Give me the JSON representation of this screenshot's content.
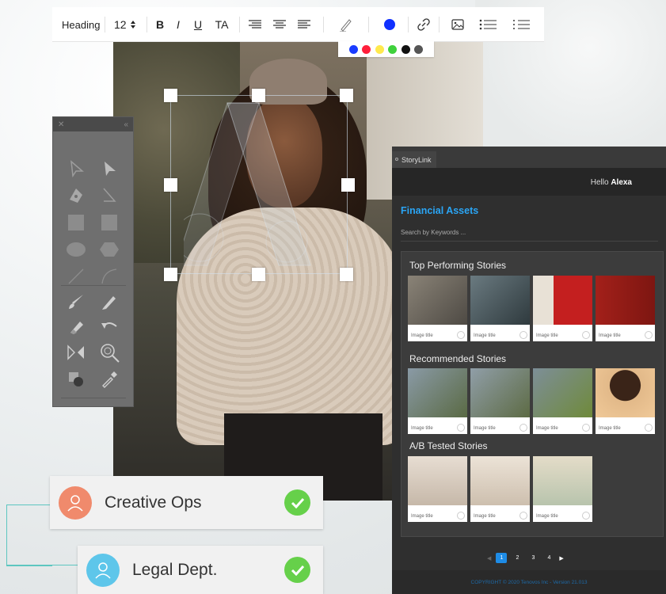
{
  "toolbar": {
    "style_label": "Heading",
    "font_size": "12",
    "bold": "B",
    "italic": "I",
    "underline": "U",
    "text_case": "TA",
    "current_color": "#1030ff",
    "palette": [
      "#1a3cff",
      "#ff1f3b",
      "#ffe94d",
      "#3fd13c",
      "#111111",
      "#555555"
    ]
  },
  "storylink": {
    "tab_label": "StoryLink",
    "greeting_prefix": "Hello",
    "user_name": "Alexa",
    "page_title": "Financial Assets",
    "search_placeholder": "Search by Keywords ...",
    "sections": [
      {
        "title": "Top Performing Stories",
        "cards": [
          {
            "caption": "Image title",
            "tone": "#6b6a66"
          },
          {
            "caption": "Image title",
            "tone": "#4d5a5e"
          },
          {
            "caption": "Image title",
            "tone": "#b01c1c"
          },
          {
            "caption": "Image title",
            "tone": "#9a1d18"
          }
        ]
      },
      {
        "title": "Recommended Stories",
        "cards": [
          {
            "caption": "Image title",
            "tone": "#5b6a4a"
          },
          {
            "caption": "Image title",
            "tone": "#5f6b52"
          },
          {
            "caption": "Image title",
            "tone": "#7a8a93"
          },
          {
            "caption": "Image title",
            "tone": "#e0b58a"
          }
        ]
      },
      {
        "title": "A/B Tested Stories",
        "cards": [
          {
            "caption": "Image title",
            "tone": "#d6c8b8"
          },
          {
            "caption": "Image title",
            "tone": "#d8cbbd"
          },
          {
            "caption": "Image title",
            "tone": "#cbbfa6"
          }
        ]
      }
    ],
    "pagination": [
      "1",
      "2",
      "3",
      "4"
    ],
    "current_page": "1",
    "copyright": "COPYRIGHT © 2020 Tenovos Inc - Version 21.013"
  },
  "approvals": [
    {
      "label": "Creative Ops",
      "avatar_color": "#f08a6c",
      "status": "approved"
    },
    {
      "label": "Legal Dept.",
      "avatar_color": "#5ec6ea",
      "status": "approved"
    }
  ]
}
